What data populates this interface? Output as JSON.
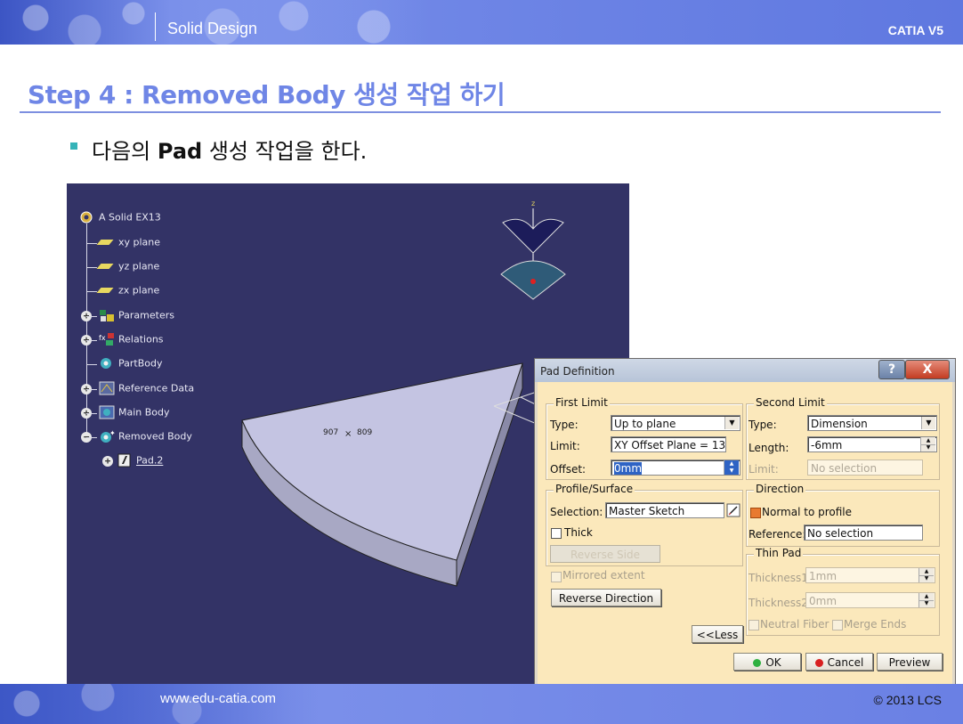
{
  "header": {
    "title": "Solid Design",
    "brand": "CATIA V5"
  },
  "step_heading": "Step 4 : Removed Body 생성 작업 하기",
  "bullet": {
    "pre": "다음의 ",
    "bold": "Pad",
    "post": " 생성 작업을 한다."
  },
  "tree": {
    "root": "A Solid EX13",
    "items": [
      {
        "label": "xy plane"
      },
      {
        "label": "yz plane"
      },
      {
        "label": "zx plane"
      },
      {
        "label": "Parameters"
      },
      {
        "label": "Relations"
      },
      {
        "label": "PartBody"
      },
      {
        "label": "Reference Data"
      },
      {
        "label": "Main Body"
      },
      {
        "label": "Removed Body"
      },
      {
        "label": "Pad.2"
      }
    ]
  },
  "viewport": {
    "dim_a": "907",
    "dim_b": "809",
    "compass_z": "z"
  },
  "dialog": {
    "title": "Pad Definition",
    "help": "?",
    "close": "X",
    "first_limit": {
      "group": "First Limit",
      "type_label": "Type:",
      "type_value": "Up to plane",
      "limit_label": "Limit:",
      "limit_value": "XY Offset Plane = 13.",
      "offset_label": "Offset:",
      "offset_value": "0mm"
    },
    "second_limit": {
      "group": "Second Limit",
      "type_label": "Type:",
      "type_value": "Dimension",
      "length_label": "Length:",
      "length_value": "-6mm",
      "limit_label": "Limit:",
      "limit_value": "No selection"
    },
    "profile": {
      "group": "Profile/Surface",
      "selection_label": "Selection:",
      "selection_value": "Master Sketch",
      "thick_label": "Thick",
      "reverse_side": "Reverse Side"
    },
    "direction": {
      "group": "Direction",
      "normal_label": "Normal to profile",
      "reference_label": "Reference:",
      "reference_value": "No selection"
    },
    "thin_pad": {
      "group": "Thin Pad",
      "thickness1_label": "Thickness1:",
      "thickness1_value": "1mm",
      "thickness2_label": "Thickness2:",
      "thickness2_value": "0mm",
      "neutral_label": "Neutral Fiber",
      "merge_label": "Merge Ends"
    },
    "mirrored_label": "Mirrored extent",
    "reverse_direction": "Reverse Direction",
    "less": "<<Less",
    "ok": "OK",
    "cancel": "Cancel",
    "preview": "Preview"
  },
  "footer": {
    "url": "www.edu-catia.com",
    "copyright": "© 2013 LCS"
  },
  "colors": {
    "accent": "#6f86e6",
    "viewport_bg": "#333366",
    "dialog_bg": "#fbe8bb"
  }
}
